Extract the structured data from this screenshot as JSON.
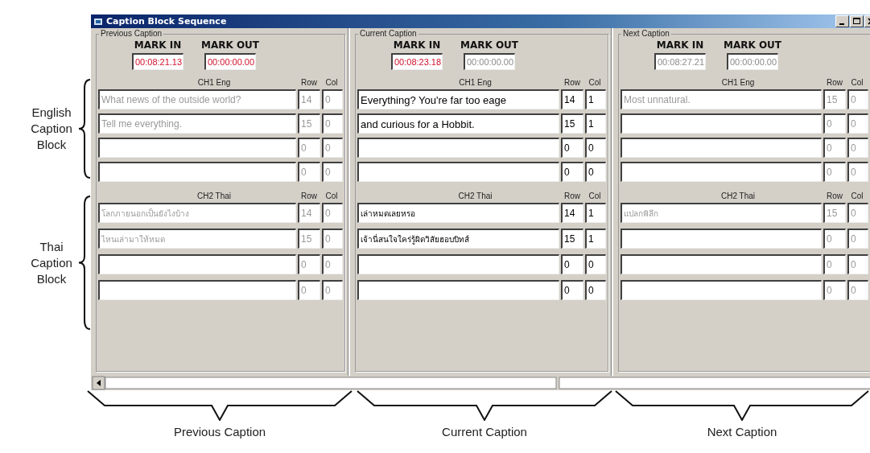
{
  "window": {
    "title": "Caption Block Sequence"
  },
  "panels": [
    {
      "title": "Previous Caption",
      "disabled": true,
      "mark_in": {
        "label": "MARK IN",
        "value": "00:08:21.13",
        "highlighted": true
      },
      "mark_out": {
        "label": "MARK OUT",
        "value": "00:00:00.00",
        "highlighted": true
      },
      "channels": [
        {
          "label": "CH1 Eng",
          "row_label": "Row",
          "col_label": "Col",
          "lines": [
            {
              "text": "What news of the outside world?",
              "row": "14",
              "col": "0"
            },
            {
              "text": "Tell me everything.",
              "row": "15",
              "col": "0"
            },
            {
              "row": "0",
              "col": "0"
            },
            {
              "row": "0",
              "col": "0"
            }
          ]
        },
        {
          "label": "CH2 Thai",
          "row_label": "Row",
          "col_label": "Col",
          "lines": [
            {
              "text": "โลกภายนอกเป็นยังไงบ้าง",
              "row": "14",
              "col": "0"
            },
            {
              "text": "ไหนเล่ามาให้หมด",
              "row": "15",
              "col": "0"
            },
            {
              "row": "0",
              "col": "0"
            },
            {
              "row": "0",
              "col": "0"
            }
          ]
        }
      ]
    },
    {
      "title": "Current Caption",
      "disabled": false,
      "mark_in": {
        "label": "MARK IN",
        "value": "00:08:23.18",
        "highlighted": true
      },
      "mark_out": {
        "label": "MARK OUT",
        "value": "00:00:00.00",
        "highlighted": false
      },
      "channels": [
        {
          "label": "CH1 Eng",
          "row_label": "Row",
          "col_label": "Col",
          "lines": [
            {
              "text": "Everything? You're far too eage",
              "row": "14",
              "col": "1"
            },
            {
              "text": "and curious for a Hobbit.",
              "row": "15",
              "col": "1"
            },
            {
              "row": "0",
              "col": "0"
            },
            {
              "row": "0",
              "col": "0"
            }
          ]
        },
        {
          "label": "CH2 Thai",
          "row_label": "Row",
          "col_label": "Col",
          "lines": [
            {
              "text": "เล่าหมดเลยหรอ",
              "row": "14",
              "col": "1"
            },
            {
              "text": "เจ้านี่สนใจใคร่รู้ผิดวิสัยฮอบบิทส์",
              "row": "15",
              "col": "1"
            },
            {
              "row": "0",
              "col": "0"
            },
            {
              "row": "0",
              "col": "0"
            }
          ]
        }
      ]
    },
    {
      "title": "Next Caption",
      "disabled": true,
      "mark_in": {
        "label": "MARK IN",
        "value": "00:08:27.21",
        "highlighted": false
      },
      "mark_out": {
        "label": "MARK OUT",
        "value": "00:00:00.00",
        "highlighted": false
      },
      "channels": [
        {
          "label": "CH1 Eng",
          "row_label": "Row",
          "col_label": "Col",
          "lines": [
            {
              "text": "Most unnatural.",
              "row": "15",
              "col": "0"
            },
            {
              "row": "0",
              "col": "0"
            },
            {
              "row": "0",
              "col": "0"
            },
            {
              "row": "0",
              "col": "0"
            }
          ]
        },
        {
          "label": "CH2 Thai",
          "row_label": "Row",
          "col_label": "Col",
          "lines": [
            {
              "text": "แปลกพิลึก",
              "row": "15",
              "col": "0"
            },
            {
              "row": "0",
              "col": "0"
            },
            {
              "row": "0",
              "col": "0"
            },
            {
              "row": "0",
              "col": "0"
            }
          ]
        }
      ]
    }
  ],
  "side_annotations": [
    "English Caption Block",
    "Thai Caption Block"
  ],
  "bottom_annotations": [
    "Previous Caption",
    "Current Caption",
    "Next Caption"
  ]
}
